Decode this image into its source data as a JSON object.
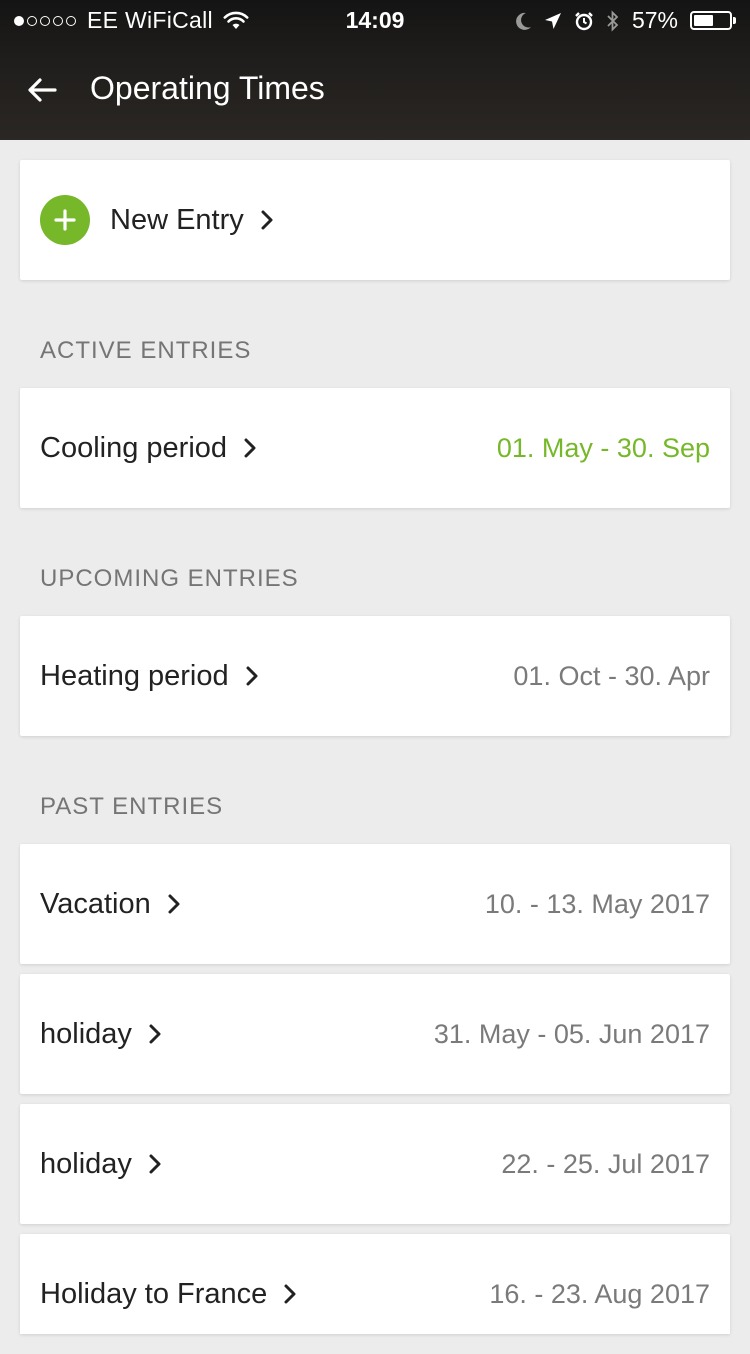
{
  "status_bar": {
    "carrier": "EE WiFiCall",
    "time": "14:09",
    "battery_percent": "57%",
    "battery_level": 0.57,
    "icons": [
      "signal-dots-icon",
      "wifi-icon",
      "moon-icon",
      "location-arrow-icon",
      "alarm-icon",
      "bluetooth-icon",
      "battery-icon"
    ]
  },
  "header": {
    "title": "Operating Times",
    "back_icon": "arrow-left-icon"
  },
  "new_entry": {
    "label": "New Entry",
    "icon": "plus-circle-icon"
  },
  "sections": {
    "active": {
      "title": "ACTIVE ENTRIES",
      "entries": [
        {
          "name": "Cooling period",
          "dates": "01. May - 30. Sep"
        }
      ]
    },
    "upcoming": {
      "title": "UPCOMING ENTRIES",
      "entries": [
        {
          "name": "Heating period",
          "dates": "01. Oct - 30. Apr"
        }
      ]
    },
    "past": {
      "title": "PAST ENTRIES",
      "entries": [
        {
          "name": "Vacation",
          "dates": "10. - 13. May 2017"
        },
        {
          "name": "holiday",
          "dates": "31. May - 05. Jun 2017"
        },
        {
          "name": "holiday",
          "dates": "22. - 25. Jul 2017"
        },
        {
          "name": "Holiday to France",
          "dates": "16. - 23. Aug 2017"
        }
      ]
    }
  },
  "colors": {
    "accent_green": "#76b82a",
    "header_bg": "#1f1d1b",
    "page_bg": "#ececec",
    "secondary_text": "#7a7a7a"
  }
}
